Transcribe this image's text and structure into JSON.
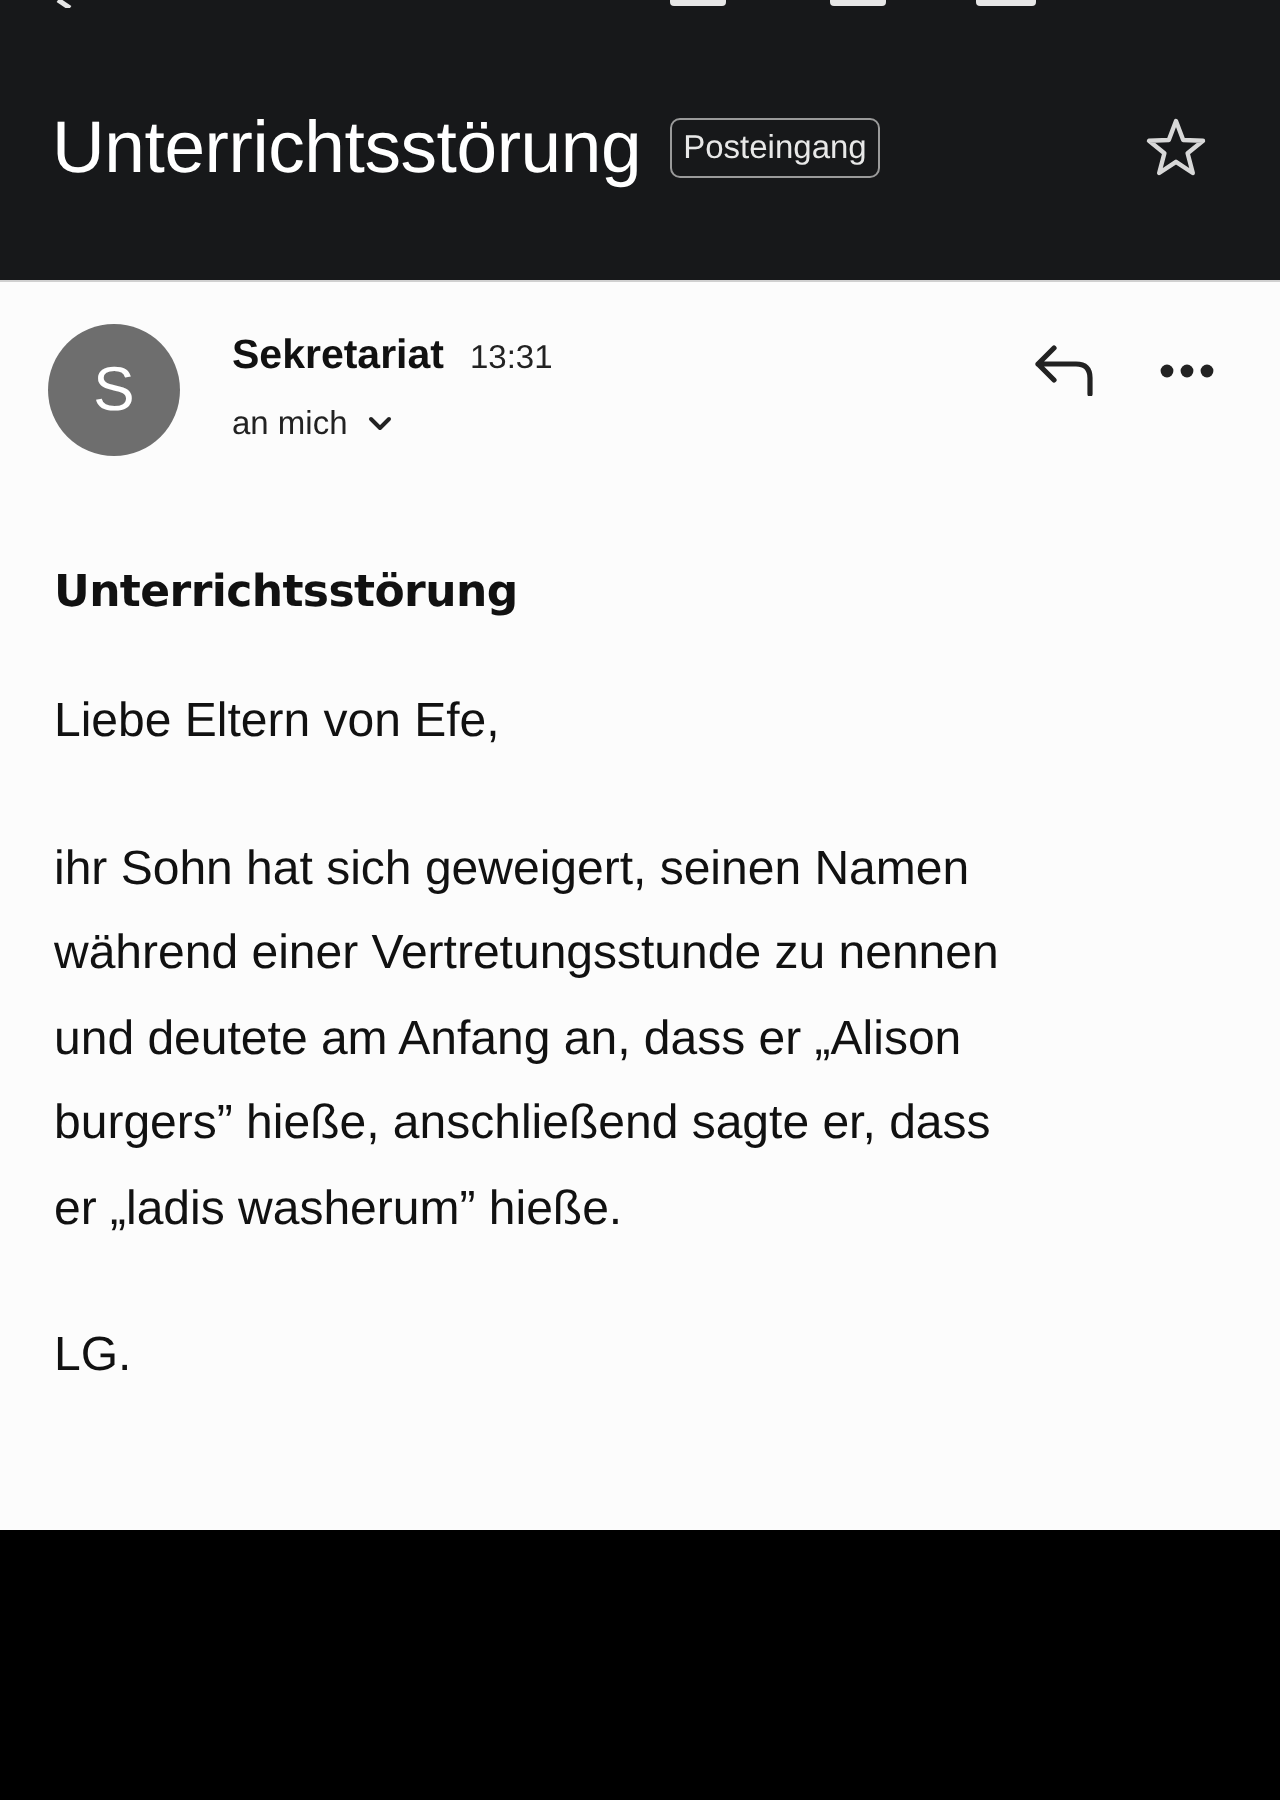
{
  "header": {
    "title": "Unterrichtsstörung",
    "label": "Posteingang",
    "starred": false
  },
  "message": {
    "sender": {
      "initial": "S",
      "name": "Sekretariat",
      "time": "13:31",
      "recipient": "an mich"
    },
    "subject": "Unterrichtsstörung",
    "body": [
      "Liebe Eltern von Efe,",
      "ihr Sohn hat sich geweigert, seinen Namen während einer Vertretungsstunde zu nennen und deutete am Anfang an, dass er „Alison burgers” hieße, anschließend sagte er, dass er „ladis washerum” hieße.",
      "LG."
    ]
  }
}
